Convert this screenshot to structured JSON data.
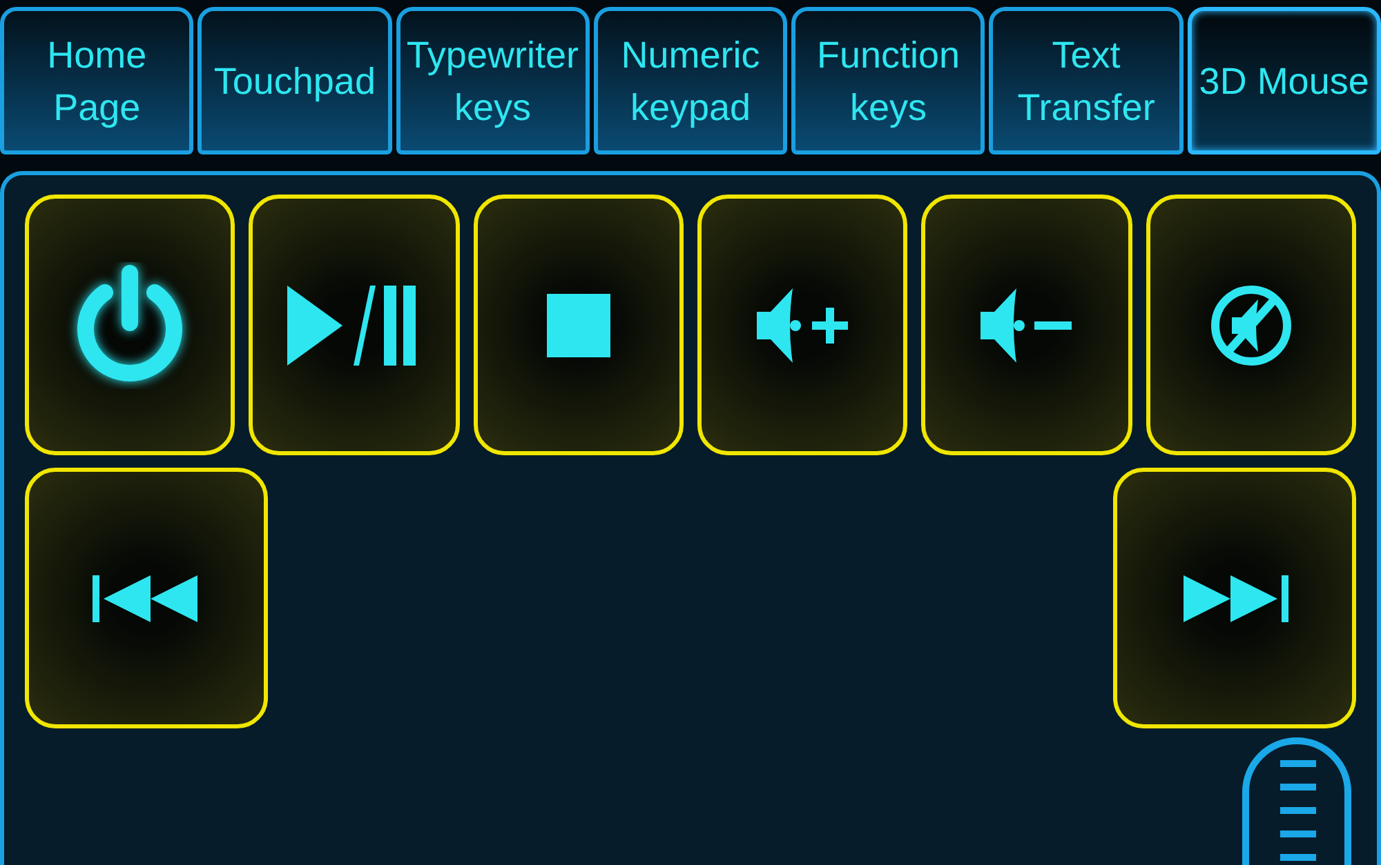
{
  "tabs": [
    {
      "label": "Home Page",
      "selected": false
    },
    {
      "label": "Touchpad",
      "selected": false
    },
    {
      "label": "Typewriter keys",
      "selected": false
    },
    {
      "label": "Numeric keypad",
      "selected": false
    },
    {
      "label": "Function keys",
      "selected": false
    },
    {
      "label": "Text Transfer",
      "selected": false
    },
    {
      "label": "3D Mouse",
      "selected": true
    }
  ],
  "keys": [
    {
      "kind": "power"
    },
    {
      "kind": "play-pause"
    },
    {
      "kind": "stop"
    },
    {
      "kind": "volume-up"
    },
    {
      "kind": "volume-down"
    },
    {
      "kind": "mute"
    },
    {
      "kind": "previous"
    },
    {
      "kind": "next"
    }
  ]
}
